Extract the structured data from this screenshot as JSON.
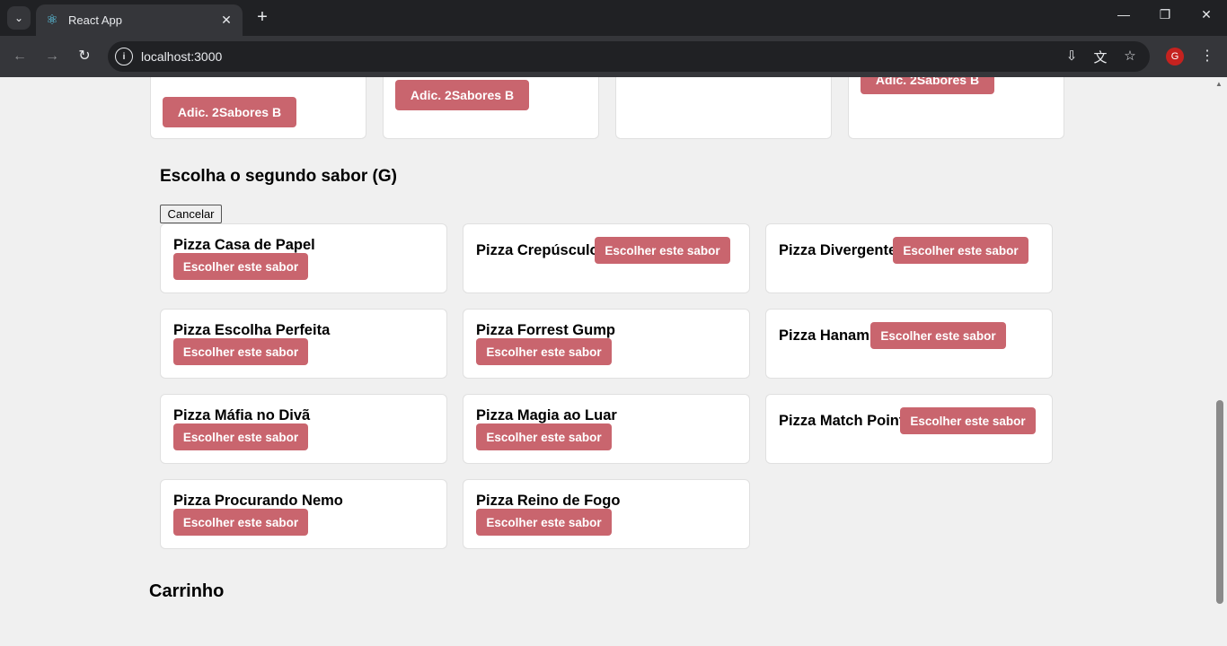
{
  "browser": {
    "tab_title": "React App",
    "url": "localhost:3000",
    "profile_initial": "G"
  },
  "top_cards": {
    "button_label": "Adic. 2Sabores B"
  },
  "flavor_section": {
    "title": "Escolha o segundo sabor (G)",
    "cancel_label": "Cancelar",
    "choose_label": "Escolher este sabor",
    "flavors": [
      "Pizza Casa de Papel",
      "Pizza Crepúsculo",
      "Pizza Divergente",
      "Pizza Escolha Perfeita",
      "Pizza Forrest Gump",
      "Pizza Hanami",
      "Pizza Máfia no Divã",
      "Pizza Magia ao Luar",
      "Pizza Match Point",
      "Pizza Procurando Nemo",
      "Pizza Reino de Fogo"
    ]
  },
  "cart": {
    "title": "Carrinho"
  },
  "colors": {
    "accent_button": "#c9656e",
    "page_background": "#f0f0f0"
  }
}
